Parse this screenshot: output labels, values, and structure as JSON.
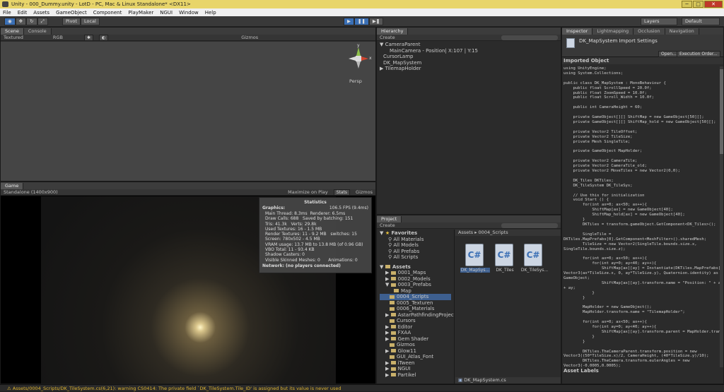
{
  "window": {
    "title": "Unity - 000_Dummy.unity - LotD - PC, Mac & Linux Standalone* <DX11>",
    "minimize": "─",
    "maximize": "□",
    "close": "✕"
  },
  "menu": [
    "File",
    "Edit",
    "Assets",
    "GameObject",
    "Component",
    "PlayMaker",
    "NGUI",
    "Window",
    "Help"
  ],
  "toolbar": {
    "pivot": "Pivot",
    "local": "Local",
    "layers": "Layers",
    "layout": "Default"
  },
  "scene": {
    "tab_scene": "Scene",
    "tab_console": "Console",
    "textured": "Textured",
    "rgb": "RGB",
    "gizmos": "Gizmos",
    "persp": "Persp",
    "axis_y": "y",
    "axis_x": "x"
  },
  "game": {
    "tab": "Game",
    "resolution": "Standalone (1400x900)",
    "maximize": "Maximize on Play",
    "stats": "Stats",
    "gizmos": "Gizmos"
  },
  "statistics": {
    "title": "Statistics",
    "graphics_label": "Graphics:",
    "fps": "106.5 FPS (9.4ms)",
    "lines": [
      "Main Thread: 8.3ms  Renderer: 6.5ms",
      "Draw Calls: 688   Saved by batching: 151",
      "Tris: 41.3k   Verts: 29.8k",
      "Used Textures: 16 - 1.5 MB",
      "Render Textures: 11 - 9.2 MB   switches: 15",
      "Screen: 780x502 - 4.5 MB",
      "VRAM usage: 13.7 MB to 13.8 MB (of 0.96 GB)",
      "VBO Total: 11 - 93.4 KB",
      "Shadow Casters: 0",
      "Visible Skinned Meshes: 0      Animations: 0"
    ],
    "network": "Network: (no players connected)"
  },
  "hierarchy": {
    "tab": "Hierarchy",
    "create": "Create",
    "items": [
      "▼ CameraParent",
      "MainCamera - Position| X:107 | Y:15",
      "CursorLamp",
      "DK_MapSystem",
      "▶ TilemapHolder"
    ]
  },
  "project": {
    "tab": "Project",
    "create": "Create",
    "favorites": "Favorites",
    "fav_items": [
      "All Materials",
      "All Models",
      "All Prefabs",
      "All Scripts"
    ],
    "assets": "Assets",
    "folders": [
      "0001_Maps",
      "0002_Models",
      "0003_Prefabs",
      "Map",
      "0004_Scripts",
      "0005_Texturen",
      "0006_Materials",
      "AstarPathfindingProject",
      "Cursors",
      "Editor",
      "FXAA",
      "Gem Shader",
      "Gizmos",
      "Glow11",
      "GUI_Atlas_Font",
      "iTween",
      "NGUI",
      "Partikel"
    ],
    "breadcrumb": "Assets ▸ 0004_Scripts",
    "files": [
      "DK_MapSys...",
      "DK_Tiles",
      "DK_TileSys..."
    ],
    "selected_file": "DK_MapSystem.cs"
  },
  "inspector": {
    "tabs": [
      "Inspector",
      "Lightmapping",
      "Occlusion",
      "Navigation"
    ],
    "title": "DK_MapSystem Import Settings",
    "open": "Open...",
    "exec": "Execution Order...",
    "imported": "Imported Object",
    "asset_labels": "Asset Labels",
    "code": "using UnityEngine;\nusing System.Collections;\n\npublic class DK_MapSystem : MonoBehaviour {\n    public float ScrollSpeed = 20.0f;\n    public float ZoomSpeed = 10.0f;\n    public float Scroll_Width = 10.0f;\n\n    public int CameraHeight = 60;\n\n    private GameObject[][] ShiftMap = new GameObject[50][];\n    private GameObject[][] ShiftMap_hold = new GameObject[50][];\n\n    private Vector2 TileOffset;\n    private Vector2 TileSize;\n    private Mesh SingleTile;\n\n    private GameObject MapHolder;\n\n    private Vector2 CameraTile;\n    private Vector2 CameraTile_old;\n    private Vector2 MoveTiles = new Vector2(0,0);\n\n    DK_Tiles DKTiles;\n    DK_TileSystem DK_TileSys;\n\n    // Use this for initialization\n    void Start () {\n        for(int ax=0; ax<50; ax++){\n            ShiftMap[ax] = new GameObject[40];\n            ShiftMap_hold[ax] = new GameObject[40];\n        }\n        DKTiles = transform.gameObject.GetComponent<DK_Tiles>();\n\n        SingleTile =\nDKTiles.MapPrefabs[0].GetComponent<MeshFilter>().sharedMesh;\n        TileSize = new Vector2(SingleTile.bounds.size.x,\nSingleTile.bounds.size.z);\n\n        for(int ax=0; ax<50; ax++){\n            for(int ay=0; ay<40; ay++){\n                ShiftMap[ax][ay] = Instantiate(DKTiles.MapPrefabs[0], new\nVector3(ax*TileSize.x, 0, ay*TileSize.y), Quaternion.identity) as\nGameObject;\n                ShiftMap[ax][ay].transform.name = \"Position: \" + ax + \" | \"\n+ ay;\n            }\n        }\n\n        MapHolder = new GameObject();\n        MapHolder.transform.name = \"TilemapHolder\";\n\n        for(int ax=0; ax<50; ax++){\n            for(int ay=0; ay<40; ay++){\n                ShiftMap[ax][ay].transform.parent = MapHolder.transform;\n            }\n        }\n\n        DKTiles.TheCameraParent.transform.position = new\nVector3((50*TileSize.x)/2, CameraHeight, (40*TileSize.y)/10);\n        DKTiles.TheCamera.transform.eulerAngles = new\nVector3(-0.0005,0.0005);"
  },
  "status": {
    "message": "Assets/0004_Scripts/DK_TileSystem.cs(6,21): warning CS0414: The private field `DK_TileSystem.Tile_ID' is assigned but its value is never used"
  },
  "colors": {
    "title_bg": "#e8d56a",
    "play_active": "#3a6fb5",
    "warning": "#e0b530",
    "panel": "#2b2b2b"
  }
}
